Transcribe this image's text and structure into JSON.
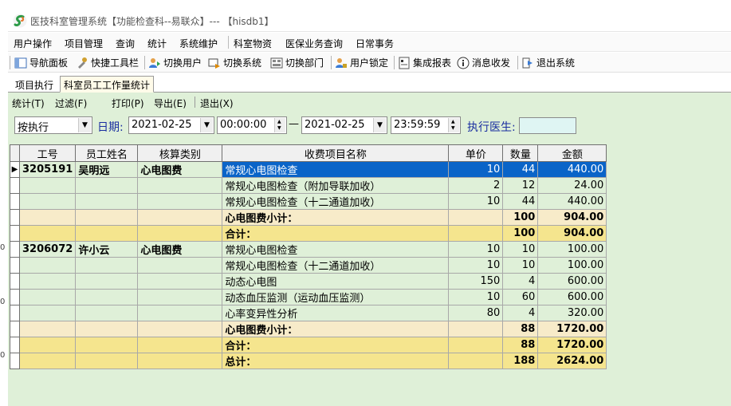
{
  "window": {
    "title": "医技科室管理系统【功能检查科--易联众】--- 【hisdb1】"
  },
  "menu": [
    "用户操作",
    "项目管理",
    "查询",
    "统计",
    "系统维护",
    "科室物资",
    "医保业务查询",
    "日常事务"
  ],
  "toolbar": [
    "导航面板",
    "快捷工具栏",
    "切换用户",
    "切换系统",
    "切换部门",
    "用户锁定",
    "集成报表",
    "消息收发",
    "退出系统"
  ],
  "tabs": [
    "项目执行",
    "科室员工工作量统计"
  ],
  "subtoolbar": [
    "统计(T)",
    "过滤(F)",
    "打印(P)",
    "导出(E)",
    "退出(X)"
  ],
  "filter": {
    "mode": "按执行",
    "date_label": "日期:",
    "start_date": "2021-02-25",
    "start_time": "00:00:00",
    "dash": "—",
    "end_date": "2021-02-25",
    "end_time": "23:59:59",
    "doctor_label": "执行医生:",
    "doctor_value": ""
  },
  "gutter": [
    "0",
    "0",
    "0"
  ],
  "grid": {
    "columns": [
      "工号",
      "员工姓名",
      "核算类别",
      "收费项目名称",
      "单价",
      "数量",
      "金额"
    ],
    "rows": [
      {
        "kind": "sel",
        "id": "3205191",
        "name": "吴明远",
        "cat": "心电图费",
        "item": "常规心电图检查",
        "price": "10",
        "qty": "44",
        "amount": "440.00"
      },
      {
        "kind": "",
        "id": "",
        "name": "",
        "cat": "",
        "item": "常规心电图检查（附加导联加收）",
        "price": "2",
        "qty": "12",
        "amount": "24.00"
      },
      {
        "kind": "",
        "id": "",
        "name": "",
        "cat": "",
        "item": "常规心电图检查（十二通道加收）",
        "price": "10",
        "qty": "44",
        "amount": "440.00"
      },
      {
        "kind": "sub1",
        "id": "",
        "name": "",
        "cat": "",
        "item": "心电图费小计：",
        "price": "",
        "qty": "100",
        "amount": "904.00"
      },
      {
        "kind": "tot",
        "id": "",
        "name": "",
        "cat": "",
        "item": "合计：",
        "price": "",
        "qty": "100",
        "amount": "904.00"
      },
      {
        "kind": "",
        "id": "3206072",
        "name": "许小云",
        "cat": "心电图费",
        "item": "常规心电图检查",
        "price": "10",
        "qty": "10",
        "amount": "100.00"
      },
      {
        "kind": "",
        "id": "",
        "name": "",
        "cat": "",
        "item": "常规心电图检查（十二通道加收）",
        "price": "10",
        "qty": "10",
        "amount": "100.00"
      },
      {
        "kind": "",
        "id": "",
        "name": "",
        "cat": "",
        "item": "动态心电图",
        "price": "150",
        "qty": "4",
        "amount": "600.00"
      },
      {
        "kind": "",
        "id": "",
        "name": "",
        "cat": "",
        "item": "动态血压监测（运动血压监测）",
        "price": "10",
        "qty": "60",
        "amount": "600.00"
      },
      {
        "kind": "",
        "id": "",
        "name": "",
        "cat": "",
        "item": "心率变异性分析",
        "price": "80",
        "qty": "4",
        "amount": "320.00"
      },
      {
        "kind": "sub2",
        "id": "",
        "name": "",
        "cat": "",
        "item": "心电图费小计：",
        "price": "",
        "qty": "88",
        "amount": "1720.00"
      },
      {
        "kind": "tot",
        "id": "",
        "name": "",
        "cat": "",
        "item": "合计：",
        "price": "",
        "qty": "88",
        "amount": "1720.00"
      },
      {
        "kind": "tot",
        "id": "",
        "name": "",
        "cat": "",
        "item": "总计：",
        "price": "",
        "qty": "188",
        "amount": "2624.00"
      }
    ]
  },
  "colors": {
    "content_bg": "#dff0d8",
    "selection": "#0a64c8",
    "subtotal": "#f7ebc9",
    "total": "#f5e58e",
    "label_blue": "#1a2ea0"
  }
}
